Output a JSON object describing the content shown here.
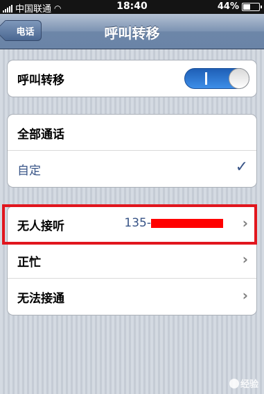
{
  "status_bar": {
    "carrier": "中国联通",
    "time": "18:40",
    "battery": "44%",
    "battery_level": 0.44
  },
  "nav": {
    "back_label": "电话",
    "title": "呼叫转移"
  },
  "toggle_section": {
    "label": "呼叫转移",
    "on": true
  },
  "scope_options": [
    {
      "label": "全部通话",
      "selected": false
    },
    {
      "label": "自定",
      "selected": true
    }
  ],
  "forward_rules": [
    {
      "label": "无人接听",
      "value": "135-"
    },
    {
      "label": "正忙",
      "value": ""
    },
    {
      "label": "无法接通",
      "value": ""
    }
  ],
  "watermark": "经验",
  "colors": {
    "nav_blue": "#6d86a8",
    "selected_blue": "#385487",
    "highlight_red": "#e1161e"
  }
}
